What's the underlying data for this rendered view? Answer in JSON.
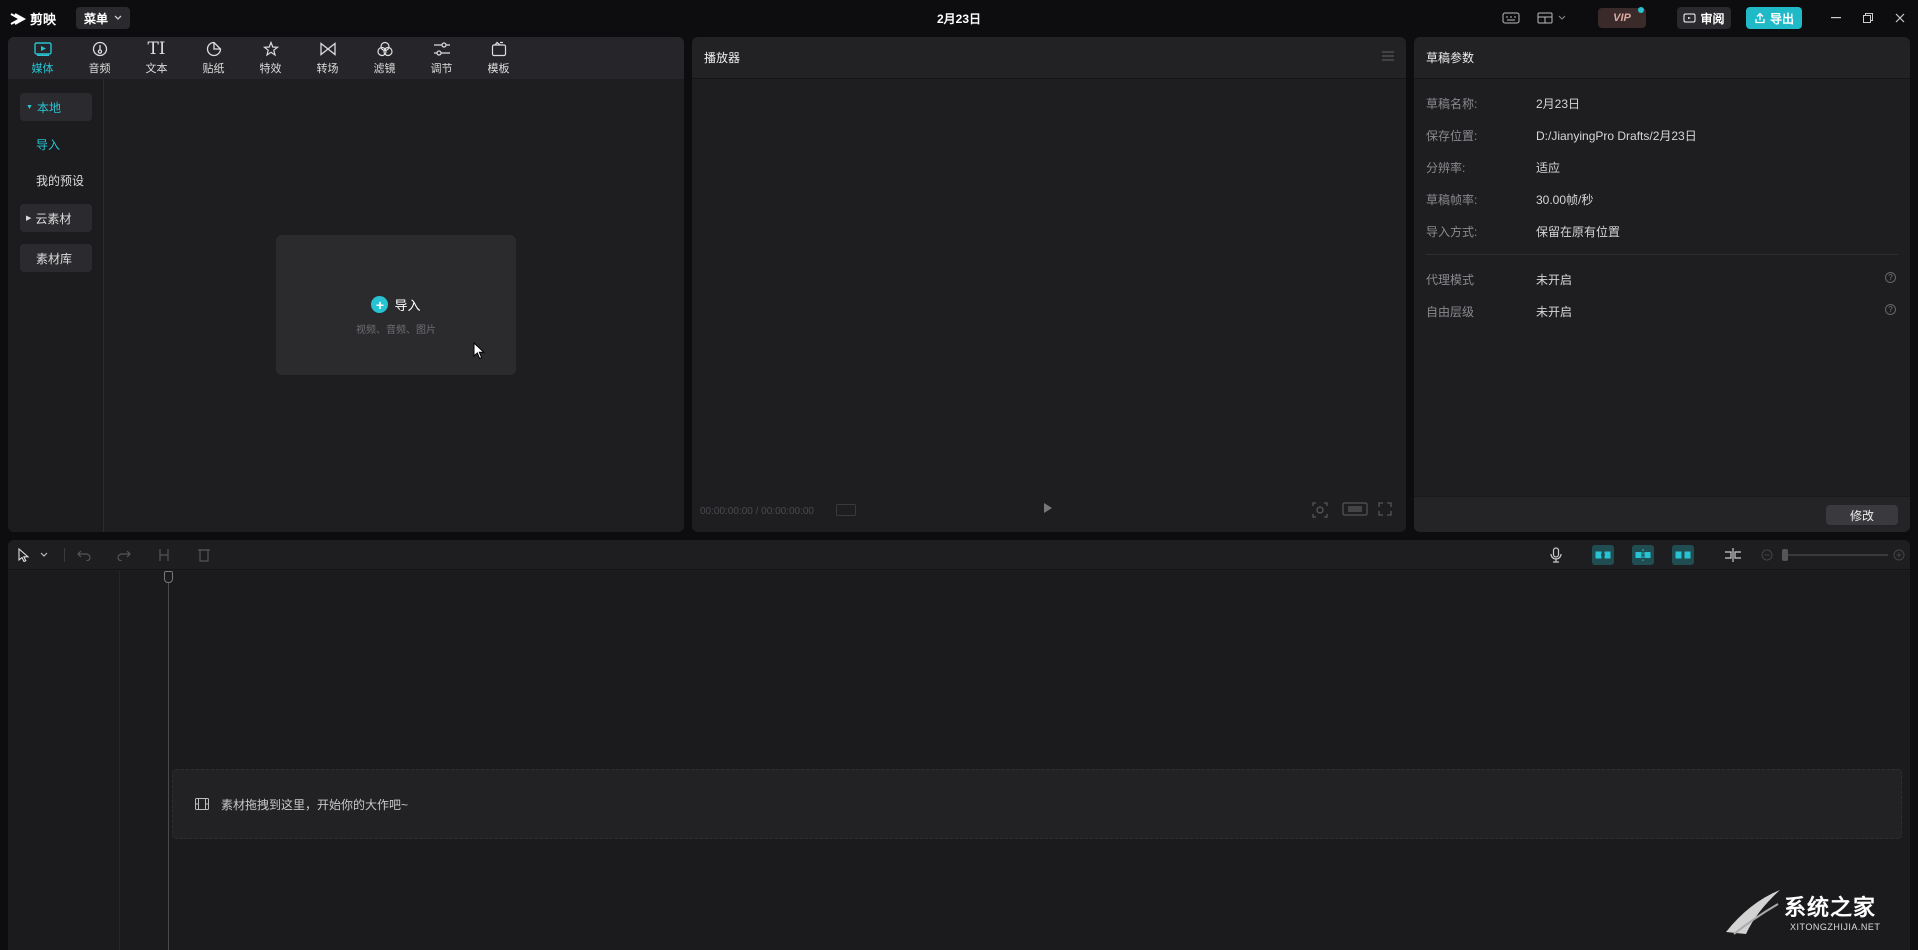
{
  "app": {
    "name": "剪映",
    "menu_label": "菜单",
    "doc_title": "2月23日"
  },
  "topbar": {
    "vip_label": "VIP",
    "review_label": "审阅",
    "export_label": "导出"
  },
  "media": {
    "tabs": [
      {
        "label": "媒体",
        "icon": "media-icon",
        "active": true
      },
      {
        "label": "音频",
        "icon": "audio-icon"
      },
      {
        "label": "文本",
        "icon": "text-icon",
        "glyph": "TI"
      },
      {
        "label": "贴纸",
        "icon": "sticker-icon"
      },
      {
        "label": "特效",
        "icon": "effects-icon"
      },
      {
        "label": "转场",
        "icon": "transition-icon"
      },
      {
        "label": "滤镜",
        "icon": "filter-icon"
      },
      {
        "label": "调节",
        "icon": "adjust-icon"
      },
      {
        "label": "模板",
        "icon": "template-icon"
      }
    ],
    "sidebar": {
      "local": "本地",
      "import": "导入",
      "presets": "我的预设",
      "cloud": "云素材",
      "library": "素材库"
    },
    "import_card": {
      "title": "导入",
      "subtitle": "视频、音频、图片"
    }
  },
  "player": {
    "title": "播放器",
    "timecode": "00:00:00:00 / 00:00:00:00"
  },
  "draft": {
    "title": "草稿参数",
    "rows": [
      {
        "label": "草稿名称:",
        "value": "2月23日"
      },
      {
        "label": "保存位置:",
        "value": "D:/JianyingPro Drafts/2月23日"
      },
      {
        "label": "分辨率:",
        "value": "适应"
      },
      {
        "label": "草稿帧率:",
        "value": "30.00帧/秒"
      },
      {
        "label": "导入方式:",
        "value": "保留在原有位置"
      }
    ],
    "rows2": [
      {
        "label": "代理模式",
        "value": "未开启"
      },
      {
        "label": "自由层级",
        "value": "未开启"
      }
    ],
    "modify_label": "修改"
  },
  "timeline": {
    "drop_hint": "素材拖拽到这里，开始你的大作吧~"
  },
  "watermark": {
    "text": "系统之家",
    "sub": "XITONGZHIJIA.NET"
  },
  "colors": {
    "accent": "#27c3d3",
    "background": "#0d0d0f",
    "panel": "#1e1e21"
  }
}
